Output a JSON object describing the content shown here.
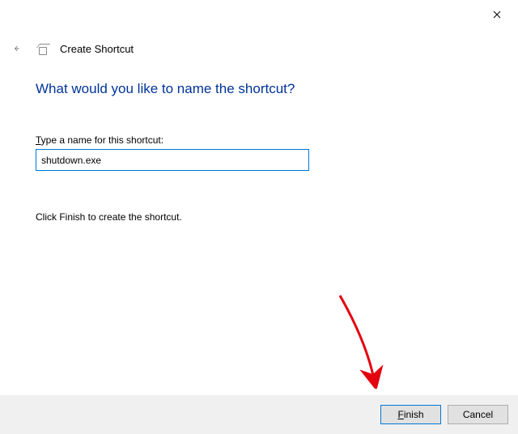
{
  "window": {
    "close_tooltip": "Close",
    "back_tooltip": "Back",
    "wizard_title": "Create Shortcut"
  },
  "page": {
    "heading": "What would you like to name the shortcut?",
    "field_label_pre": "T",
    "field_label_rest": "ype a name for this shortcut:",
    "name_value": "shutdown.exe",
    "instruction": "Click Finish to create the shortcut."
  },
  "buttons": {
    "finish_u": "F",
    "finish_rest": "inish",
    "cancel": "Cancel"
  }
}
